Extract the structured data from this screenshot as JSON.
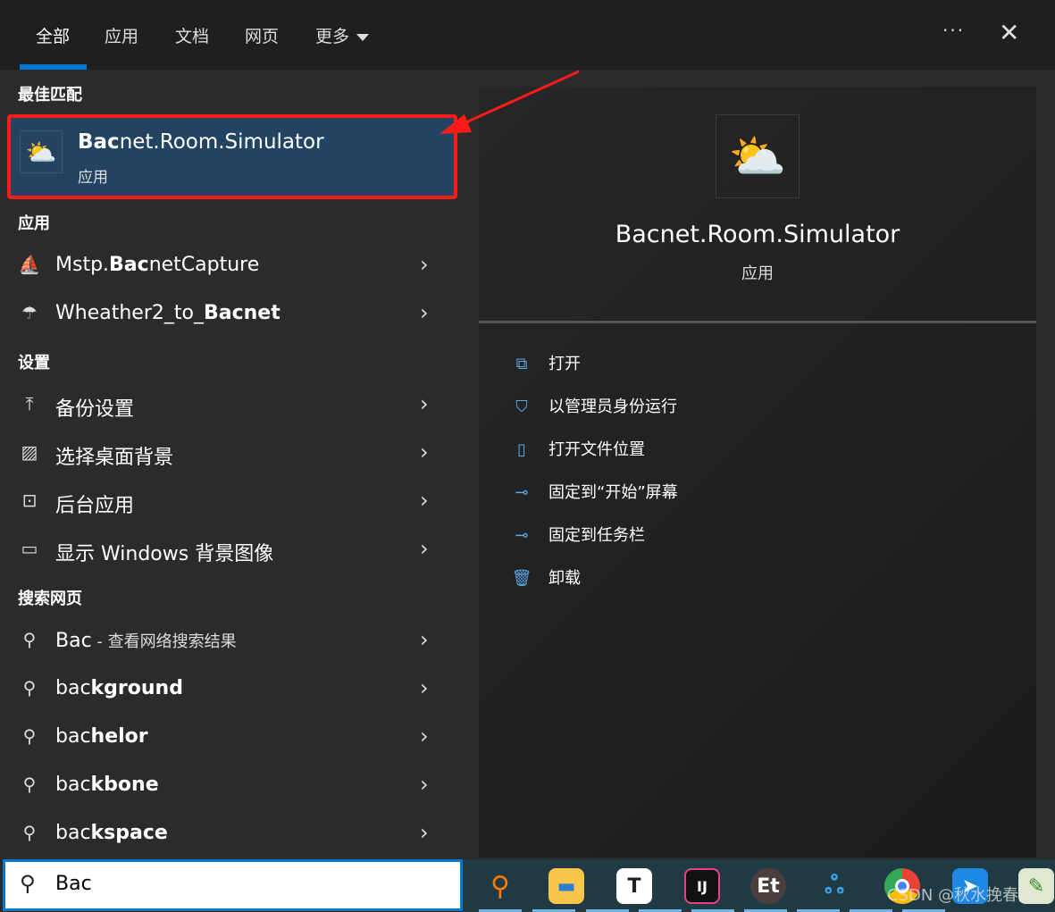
{
  "tabs": [
    {
      "label": "全部",
      "active": true
    },
    {
      "label": "应用"
    },
    {
      "label": "文档"
    },
    {
      "label": "网页"
    },
    {
      "label": "更多"
    }
  ],
  "more_icon": "ellipsis-icon",
  "close_icon": "close-icon",
  "sections": {
    "best": "最佳匹配",
    "apps": "应用",
    "settings": "设置",
    "web": "搜索网页"
  },
  "best_match": {
    "bold": "Bac",
    "rest": "net.Room.Simulator",
    "type": "应用",
    "icon": "weather-sun-cloud-icon"
  },
  "apps": [
    {
      "bold_pre": "Mstp.",
      "bold": "Bac",
      "rest": "netCapture",
      "pre": "Mstp."
    },
    {
      "pre": "Wheather2_to_",
      "bold": "Bacnet",
      "rest": ""
    }
  ],
  "settings": [
    {
      "label": "备份设置",
      "icon": "upload-icon"
    },
    {
      "label": "选择桌面背景",
      "icon": "image-icon"
    },
    {
      "label": "后台应用",
      "icon": "activity-icon"
    },
    {
      "label": "显示 Windows 背景图像",
      "icon": "monitor-icon"
    }
  ],
  "web": [
    {
      "bold": "Bac",
      "rest": "",
      "suffix": " - 查看网络搜索结果"
    },
    {
      "bold": "",
      "pre": "bac",
      "rest": "kground"
    },
    {
      "pre": "bac",
      "rest": "helor"
    },
    {
      "pre": "bac",
      "rest": "kbone"
    },
    {
      "pre": "bac",
      "rest": "kspace"
    }
  ],
  "detail": {
    "title": "Bacnet.Room.Simulator",
    "subtitle": "应用",
    "actions": [
      {
        "label": "打开",
        "icon": "open-external-icon"
      },
      {
        "label": "以管理员身份运行",
        "icon": "admin-shield-icon"
      },
      {
        "label": "打开文件位置",
        "icon": "folder-location-icon"
      },
      {
        "label": "固定到“开始”屏幕",
        "icon": "pin-icon"
      },
      {
        "label": "固定到任务栏",
        "icon": "pin-icon"
      },
      {
        "label": "卸载",
        "icon": "trash-icon"
      }
    ]
  },
  "search": {
    "value": "Bac"
  },
  "taskbar": [
    "search-app",
    "file-explorer",
    "typora",
    "intellij-idea",
    "et-app",
    "netbeans",
    "chrome",
    "feishu",
    "notepad-plus-plus"
  ],
  "watermark": "CSDN @秋水挽春风",
  "annotation_color": "#ff1a1a"
}
